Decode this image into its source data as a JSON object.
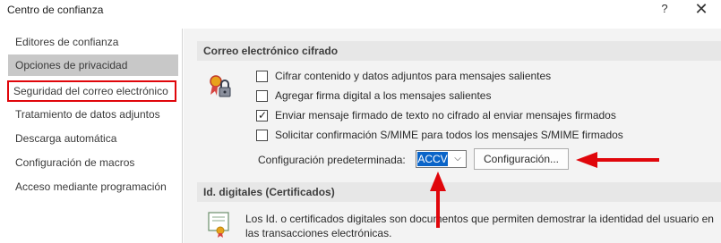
{
  "window": {
    "title": "Centro de confianza",
    "help_glyph": "?",
    "close_glyph": "✕"
  },
  "sidebar": {
    "items": [
      {
        "label": "Editores de confianza"
      },
      {
        "label": "Opciones de privacidad"
      },
      {
        "label": "Seguridad del correo electrónico"
      },
      {
        "label": "Tratamiento de datos adjuntos"
      },
      {
        "label": "Descarga automática"
      },
      {
        "label": "Configuración de macros"
      },
      {
        "label": "Acceso mediante programación"
      }
    ]
  },
  "encrypted_mail": {
    "title": "Correo electrónico cifrado",
    "options": [
      {
        "label": "Cifrar contenido y datos adjuntos para mensajes salientes",
        "checked": false
      },
      {
        "label": "Agregar firma digital a los mensajes salientes",
        "checked": false
      },
      {
        "label": "Enviar mensaje firmado de texto no cifrado al enviar mensajes firmados",
        "checked": true
      },
      {
        "label": "Solicitar confirmación S/MIME para todos los mensajes S/MIME firmados",
        "checked": false
      }
    ],
    "default_setting_label": "Configuración predeterminada:",
    "default_setting_value": "ACCV",
    "settings_button": "Configuración..."
  },
  "digital_ids": {
    "title": "Id. digitales (Certificados)",
    "description": "Los Id. o certificados digitales son documentos que permiten demostrar la identidad del usuario en las transacciones electrónicas."
  },
  "colors": {
    "highlight_box": "#e0060b",
    "annotation_arrow": "#e0060b",
    "selected_value": "#0a64c8"
  },
  "icons": {
    "mail_security": "certificate-lock-icon",
    "certificate": "certificate-icon",
    "dropdown": "chevron-down-icon"
  }
}
